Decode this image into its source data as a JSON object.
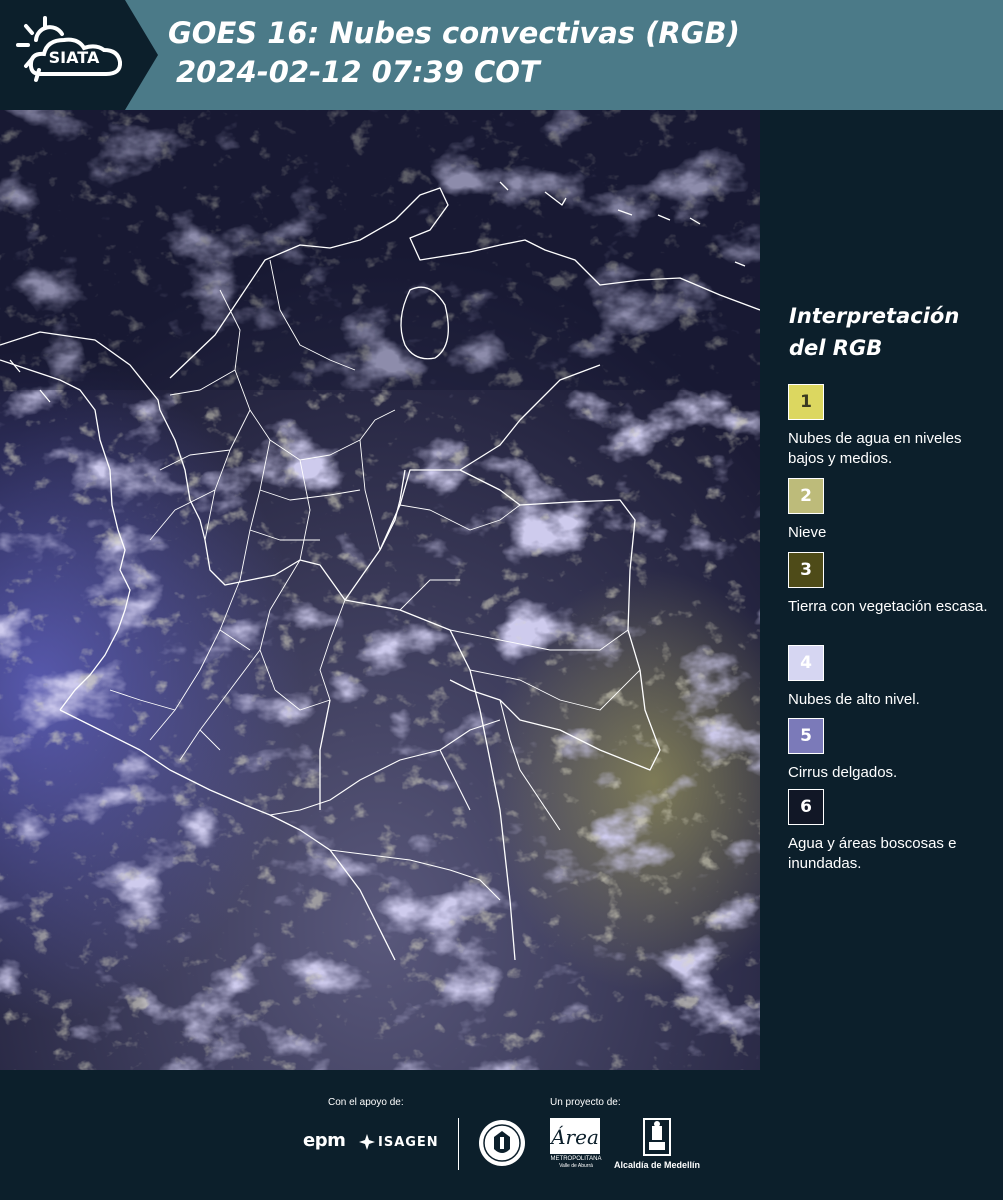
{
  "header": {
    "logo_text": "SIATA",
    "title_line1": "GOES 16: Nubes convectivas (RGB)",
    "title_line2": "2024-02-12 07:39 COT"
  },
  "legend": {
    "title": "Interpretación del RGB",
    "items": [
      {
        "number": "1",
        "label": "Nubes de agua en niveles bajos y medios.",
        "color": "#dcd760",
        "text_color": "#3a3a20"
      },
      {
        "number": "2",
        "label": "Nieve",
        "color": "#bdbb7a",
        "text_color": "#ffffff"
      },
      {
        "number": "3",
        "label": "Tierra con vegetación escasa.",
        "color": "#4e4b18",
        "text_color": "#ffffff"
      },
      {
        "number": "4",
        "label": "Nubes de alto nivel.",
        "color": "#d6d6f2",
        "text_color": "#ffffff"
      },
      {
        "number": "5",
        "label": "Cirrus delgados.",
        "color": "#7b7ab9",
        "text_color": "#ffffff"
      },
      {
        "number": "6",
        "label": "Agua y áreas boscosas e inundadas.",
        "color": "#111726",
        "text_color": "#ffffff"
      }
    ]
  },
  "footer": {
    "support_label": "Con el apoyo de:",
    "project_label": "Un proyecto de:",
    "sponsors": [
      "epm",
      "ISAGEN"
    ],
    "area_logo_text": "Área",
    "area_caption_line1": "METROPOLITANA",
    "area_caption_line2": "Valle de Aburrá",
    "alcaldia_caption": "Alcaldía de Medellín"
  },
  "colors": {
    "header_bg": "#4b7a88",
    "panel_bg": "#0c1f2b",
    "map_base": "#1b1b35",
    "border_lines": "#ffffff"
  }
}
